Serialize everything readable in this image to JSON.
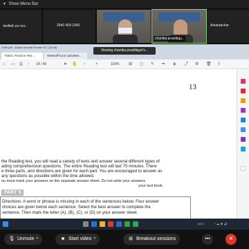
{
  "top_menu": {
    "label": "Show Menu Bar"
  },
  "participants": {
    "tile1_name": "ชยพัทธ์ สบายจ..",
    "tile2_name": "2640 409 2340",
    "tile3_label": "",
    "tile4_label": "chanika prasittigu..",
    "tile5_name": "Amantachar"
  },
  "viewing_banner": "Viewing chanika prasittigun's...",
  "browser": {
    "address": "2169 pdf - Adobe Acrobat Reader DC (32-bit)",
    "tab1": "TOEIC Practice Test ...",
    "tab2": "ทดลองทำแบบ แผนทดส..."
  },
  "pdf_toolbar": {
    "page_current": "14",
    "page_total": "/ 40",
    "zoom": "116%"
  },
  "document": {
    "page_number": "13",
    "lines": [
      "the Reading test, you will read a variety of texts and answer several different types of",
      "ading comprehension questions. The entire Reading test will last 75 minutes. There",
      "e three parts, and directions are given for each part. You are encouraged to answer as",
      "any questions as possible within the time allowed.",
      "ou must mark your answers on the separate answer sheet. Do not write your answers",
      "your test book."
    ],
    "part_title": "PART 5",
    "box_lines": [
      "Directions: A word or phrase is missing in each of the sentences below. Four answer",
      "choices are given below each sentence. Select the best answer to complete the",
      "sentence. Then mark the letter (A), (B), (C), or (D) on your answer sheet."
    ],
    "footer": "rch"
  },
  "taskbar": {
    "weather": "34°C",
    "time": ""
  },
  "controls": {
    "unmute": "Unmute",
    "start_video": "Start video",
    "breakout": "Breakout sessions"
  },
  "colors": {
    "accent_green": "#7bd86c",
    "end_red": "#e0352b"
  }
}
